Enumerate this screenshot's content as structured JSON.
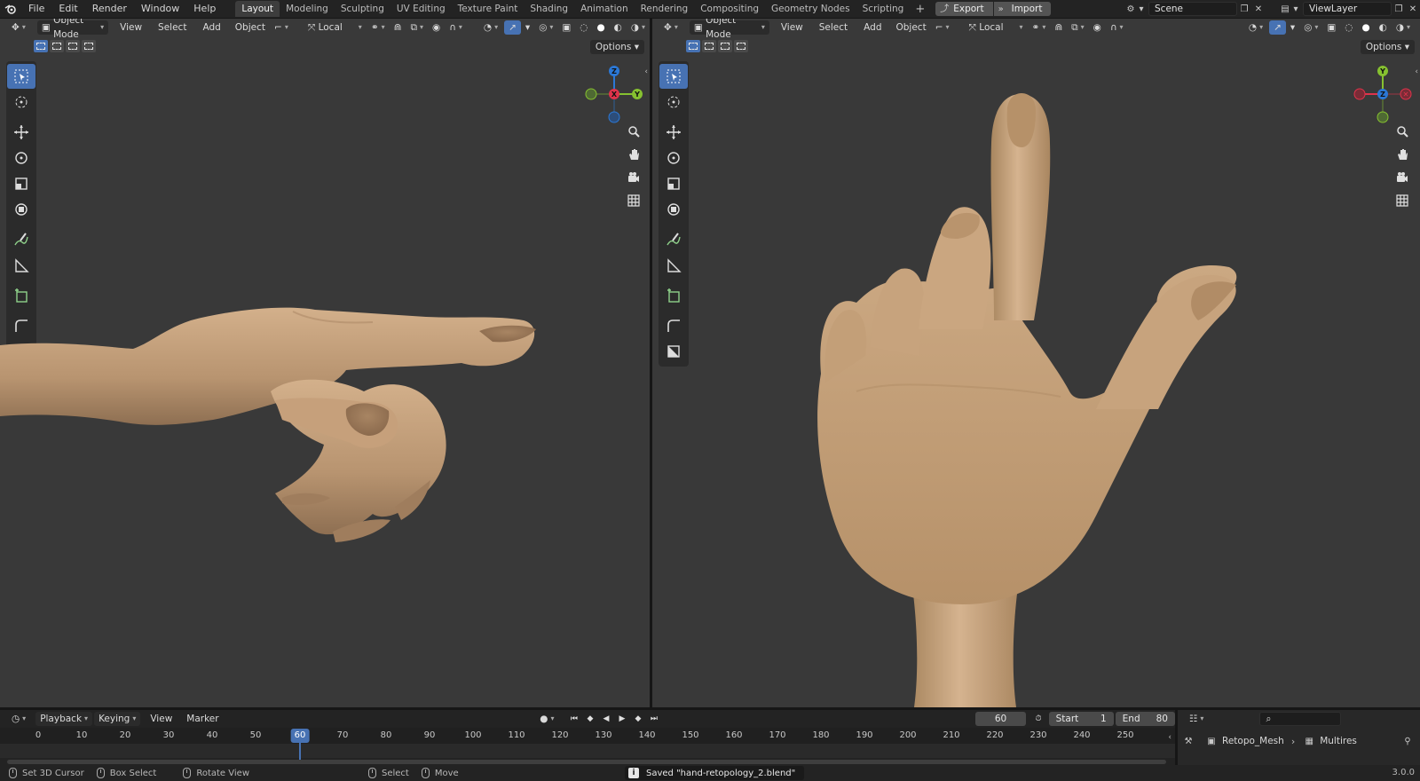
{
  "topbar": {
    "menus": [
      "File",
      "Edit",
      "Render",
      "Window",
      "Help"
    ],
    "workspaces": [
      "Layout",
      "Modeling",
      "Sculpting",
      "UV Editing",
      "Texture Paint",
      "Shading",
      "Animation",
      "Rendering",
      "Compositing",
      "Geometry Nodes",
      "Scripting"
    ],
    "active_workspace": "Layout",
    "plus": "+",
    "export_label": "Export",
    "import_label": "Import",
    "scene": "Scene",
    "view_layer": "ViewLayer"
  },
  "viewport": {
    "mode": "Object Mode",
    "menus": [
      "View",
      "Select",
      "Add",
      "Object"
    ],
    "orientation": "Local",
    "options": "Options"
  },
  "gizmo": {
    "left": {
      "top": "Z",
      "right": "Y",
      "center": "X"
    },
    "right": {
      "top": "Y",
      "center": "Z"
    }
  },
  "timeline": {
    "menus": [
      "Playback",
      "Keying",
      "View",
      "Marker"
    ],
    "current_frame": "60",
    "start_label": "Start",
    "start_value": "1",
    "end_label": "End",
    "end_value": "80",
    "ticks": [
      "0",
      "10",
      "20",
      "30",
      "40",
      "50",
      "70",
      "80",
      "90",
      "100",
      "110",
      "120",
      "130",
      "140",
      "150",
      "160",
      "170",
      "180",
      "190",
      "200",
      "210",
      "220",
      "230",
      "240",
      "250"
    ]
  },
  "outliner": {
    "object": "Retopo_Mesh",
    "modifier": "Multires"
  },
  "statusbar": {
    "hints": [
      "Set 3D Cursor",
      "Box Select",
      "Rotate View",
      "Select",
      "Move"
    ],
    "report": "Saved \"hand-retopology_2.blend\"",
    "version": "3.0.0"
  },
  "colors": {
    "accent": "#4772b3",
    "axis_x": "#e0334b",
    "axis_y": "#86c130",
    "axis_z": "#2b78d6",
    "skin": "#c5a07c"
  }
}
